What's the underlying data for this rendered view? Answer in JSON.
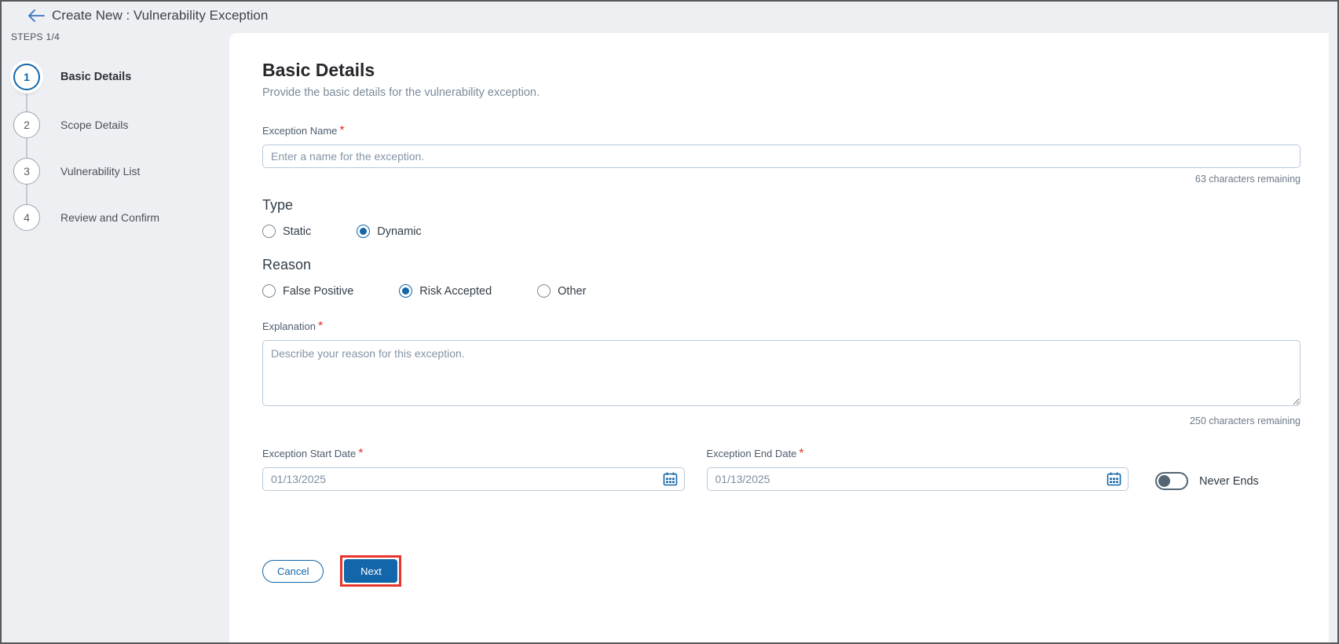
{
  "header": {
    "title": "Create New : Vulnerability Exception",
    "back_icon": "arrow-left"
  },
  "steps": {
    "label": "STEPS 1/4",
    "items": [
      {
        "number": "1",
        "label": "Basic Details",
        "active": true
      },
      {
        "number": "2",
        "label": "Scope Details",
        "active": false
      },
      {
        "number": "3",
        "label": "Vulnerability List",
        "active": false
      },
      {
        "number": "4",
        "label": "Review and Confirm",
        "active": false
      }
    ]
  },
  "main": {
    "title": "Basic Details",
    "subtitle": "Provide the basic details for the vulnerability exception.",
    "exception_name": {
      "label": "Exception Name",
      "required": "*",
      "placeholder": "Enter a name for the exception.",
      "value": "",
      "remaining": "63 characters remaining"
    },
    "type": {
      "label": "Type",
      "options": [
        {
          "label": "Static",
          "selected": false
        },
        {
          "label": "Dynamic",
          "selected": true
        }
      ]
    },
    "reason": {
      "label": "Reason",
      "options": [
        {
          "label": "False Positive",
          "selected": false
        },
        {
          "label": "Risk Accepted",
          "selected": true
        },
        {
          "label": "Other",
          "selected": false
        }
      ]
    },
    "explanation": {
      "label": "Explanation",
      "required": "*",
      "placeholder": "Describe your reason for this exception.",
      "value": "",
      "remaining": "250 characters remaining"
    },
    "start_date": {
      "label": "Exception Start Date",
      "required": "*",
      "value": "01/13/2025",
      "icon": "calendar-icon"
    },
    "end_date": {
      "label": "Exception End Date",
      "required": "*",
      "value": "01/13/2025",
      "icon": "calendar-icon"
    },
    "never_ends": {
      "label": "Never Ends",
      "on": false
    },
    "buttons": {
      "cancel": "Cancel",
      "next": "Next"
    }
  },
  "colors": {
    "accent_blue": "#1266a9",
    "back_arrow_blue": "#3a72c2",
    "required_red": "#e0342c",
    "highlight_red": "#e8352c",
    "sidebar_bg": "#edeff3",
    "input_border": "#b9c9da"
  }
}
